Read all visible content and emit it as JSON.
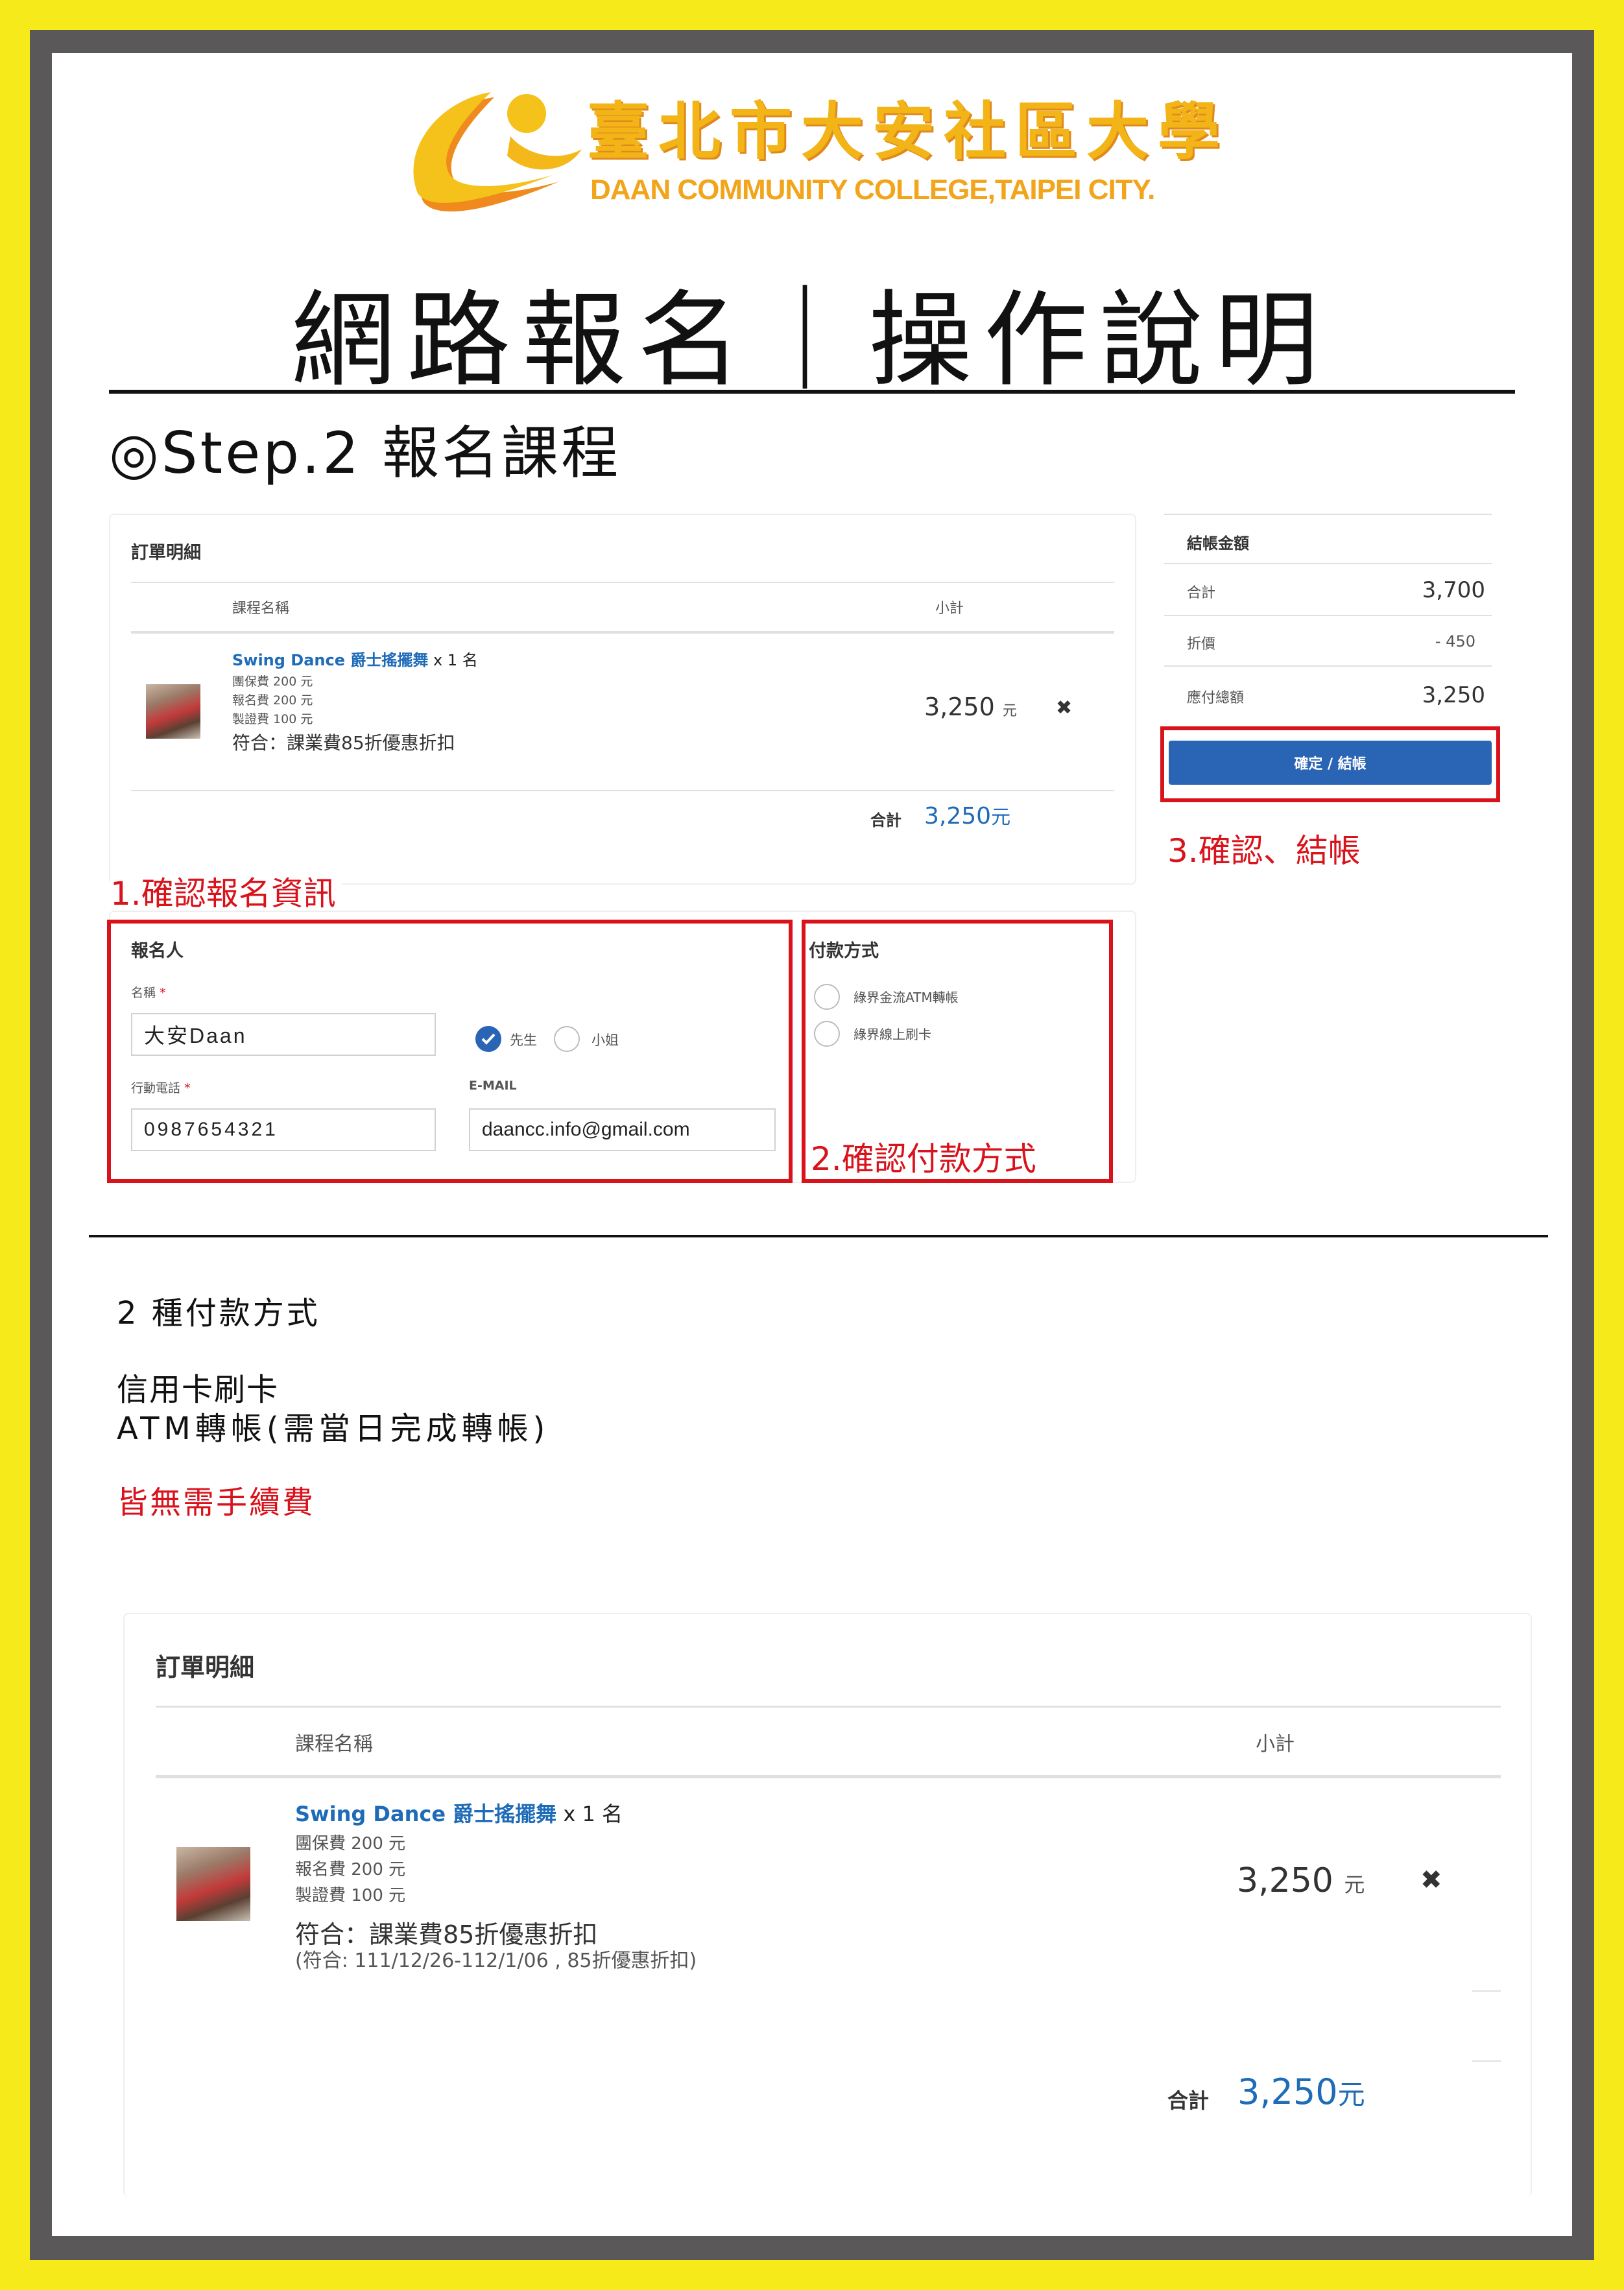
{
  "brand": {
    "name_cn": "臺北市大安社區大學",
    "name_en": "DAAN COMMUNITY COLLEGE,TAIPEI CITY.",
    "colors": {
      "accent": "#f2b417",
      "frame": "#5a5859",
      "border": "#f7ea1b",
      "highlight": "#d9131c",
      "link": "#1e6bb8",
      "button": "#2a64b4"
    }
  },
  "page": {
    "title": "網路報名｜操作說明",
    "step": "◎Step.2 報名課程"
  },
  "order": {
    "heading": "訂單明細",
    "col_course": "課程名稱",
    "col_subtotal": "小計",
    "item": {
      "name": "Swing Dance 爵士搖擺舞",
      "qty": "x 1 名",
      "fees": [
        "團保費 200 元",
        "報名費 200 元",
        "製證費 100 元"
      ],
      "discount": "符合：課業費85折優惠折扣",
      "discount_period": "(符合: 111/12/26-112/1/06 , 85折優惠折扣)",
      "price": "3,250",
      "price_unit": "元",
      "remove_icon": "times-icon"
    },
    "total_label": "合計",
    "total_value": "3,250",
    "total_unit": "元"
  },
  "checkout": {
    "heading": "結帳金額",
    "rows": [
      {
        "label": "合計",
        "value": "3,700"
      },
      {
        "label": "折價",
        "value": "- 450"
      },
      {
        "label": "應付總額",
        "value": "3,250"
      }
    ],
    "button": "確定 / 結帳"
  },
  "registrant": {
    "heading": "報名人",
    "name_label": "名稱",
    "name_value": "大安Daan",
    "gender_options": [
      {
        "label": "先生",
        "selected": true
      },
      {
        "label": "小姐",
        "selected": false
      }
    ],
    "phone_label": "行動電話",
    "phone_value": "0987654321",
    "email_label": "E-MAIL",
    "email_value": "daancc.info@gmail.com",
    "required_mark": "*"
  },
  "payment": {
    "heading": "付款方式",
    "options": [
      "綠界金流ATM轉帳",
      "綠界線上刷卡"
    ]
  },
  "annotations": {
    "step1": "1.確認報名資訊",
    "step2": "2.確認付款方式",
    "step3": "3.確認、結帳"
  },
  "notes": {
    "count": "2 種付款方式",
    "method1": "信用卡刷卡",
    "method2": "ATM轉帳(需當日完成轉帳)",
    "fee": "皆無需手續費"
  }
}
